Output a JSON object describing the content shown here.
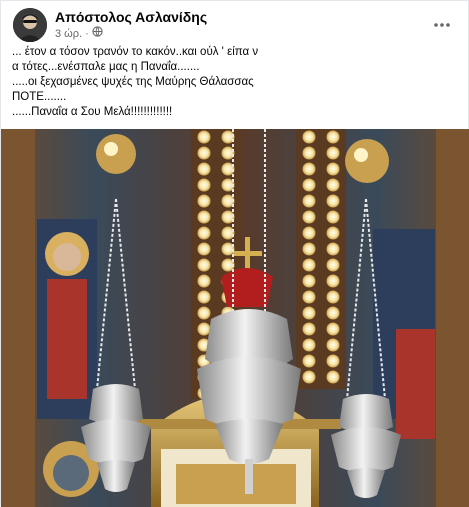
{
  "post": {
    "author": "Απόστολος Ασλανίδης",
    "time": "3 ώρ.",
    "privacy_icon": "globe-icon",
    "menu_icon": "more-options-icon",
    "text_lines": [
      "... έτον α τόσον τρανόν το κακόν..και ούλ ' είπα ν",
      "α τότες...ενέσπαλε μας η Παναΐα.......",
      ".....οι ξεχασμένες ψυχές της Μαύρης Θάλασσας",
      "ΠΟΤΕ.......",
      "......Παναΐα α Σου Μελά!!!!!!!!!!!!!"
    ],
    "photo": {
      "subject": "church-lamps-photo"
    }
  },
  "colors": {
    "author_text": "#050505",
    "secondary_text": "#65676b",
    "card_bg": "#ffffff"
  }
}
